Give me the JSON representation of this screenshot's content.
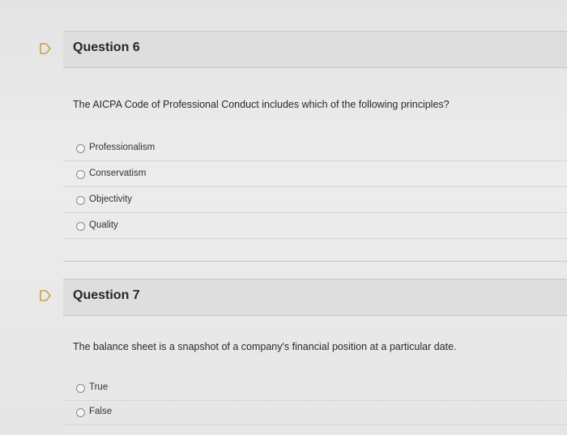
{
  "questions": [
    {
      "title": "Question 6",
      "text": "The AICPA Code of Professional Conduct includes which of the following principles?",
      "options": [
        "Professionalism",
        "Conservatism",
        "Objectivity",
        "Quality"
      ]
    },
    {
      "title": "Question 7",
      "text": "The balance sheet is a snapshot of a company's financial position at a particular date.",
      "options": [
        "True",
        "False"
      ]
    }
  ],
  "icons": {
    "flag": "flag-icon"
  }
}
